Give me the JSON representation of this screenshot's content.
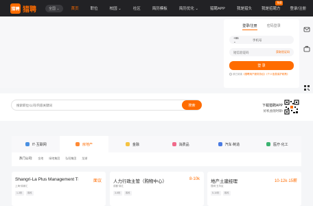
{
  "brand": {
    "logo_mark": "猎聘",
    "name": "猎聘"
  },
  "city_selector": "全国",
  "nav": {
    "items": [
      {
        "label": "首页",
        "active": true
      },
      {
        "label": "职位",
        "active": false
      },
      {
        "label": "校园 ⌄",
        "active": false
      },
      {
        "label": "社区",
        "active": false
      },
      {
        "label": "简历模板",
        "active": false
      },
      {
        "label": "简历优化 ⌄",
        "active": false
      },
      {
        "label": "猎聘APP",
        "active": false
      }
    ],
    "right": {
      "hunter": "我是猎头",
      "recruit": "我是招聘方",
      "recruit_badge": "免费",
      "login": "登录/注册"
    }
  },
  "login": {
    "tab_active": "登录/注册",
    "tab_other": "密码登录",
    "country_code": "+86 ⌄",
    "phone_placeholder": "手机号",
    "code_placeholder": "短信验证码",
    "get_code": "获取验证码",
    "button": "登 录",
    "agreement_prefix": "我已阅读",
    "agreement_links": "《猎聘用户服务协议》《个人信息保护政策》"
  },
  "search": {
    "placeholder": "搜索职位/公司/内容关键词",
    "button": "搜索"
  },
  "app_download": {
    "title": "下载猎聘APP",
    "subtitle": "好机会随时聊!"
  },
  "categories": {
    "tabs": [
      {
        "label": "IT·互联网",
        "color": "#4a90e2",
        "active": false
      },
      {
        "label": "房地产",
        "color": "#ff8a34",
        "active": true
      },
      {
        "label": "金融",
        "color": "#f5c342",
        "active": false
      },
      {
        "label": "消费品",
        "color": "#f06a8a",
        "active": false
      },
      {
        "label": "汽车·制造",
        "color": "#4a7be2",
        "active": false
      },
      {
        "label": "医疗·化工",
        "color": "#3cb371",
        "active": false
      }
    ],
    "hot_label": "热门公司:",
    "hot_companies": [
      "金地",
      "绿地集团",
      "弘阳集团",
      "龙湖"
    ]
  },
  "jobs": [
    {
      "title": "Shangri-La Plus Management Trainee",
      "salary": "面议",
      "meta": "上海·徐家汇",
      "tags": [
        "1-3年",
        "本科"
      ]
    },
    {
      "title": "人力行政主管（购物中心）",
      "salary": "8-10k",
      "meta": "成都·锦江",
      "tags": [
        "3-5年",
        "本科"
      ]
    },
    {
      "title": "地产土建经理",
      "salary": "10-12k·15薪",
      "meta": "昆明·五华区",
      "tags": [
        "5-10年",
        "本科"
      ]
    }
  ]
}
